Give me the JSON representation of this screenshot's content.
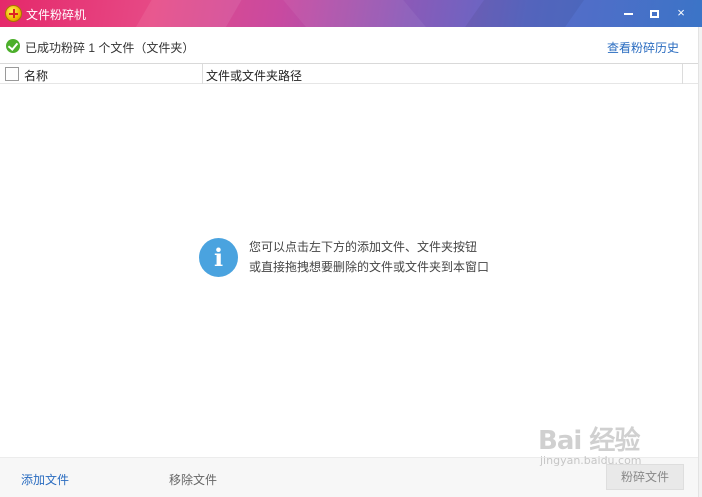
{
  "window": {
    "title": "文件粉碎机",
    "controls": {
      "minimize_icon": "minimize-icon",
      "maximize_icon": "maximize-icon",
      "close_glyph": "×"
    }
  },
  "status": {
    "message": "已成功粉碎 1 个文件（文件夹）",
    "history_link": "查看粉碎历史"
  },
  "table": {
    "columns": [
      "名称",
      "文件或文件夹路径"
    ],
    "rows": []
  },
  "empty_hint": {
    "icon_glyph": "i",
    "line1": "您可以点击左下方的添加文件、文件夹按钮",
    "line2": "或直接拖拽想要删除的文件或文件夹到本窗口"
  },
  "footer": {
    "add_file": "添加文件",
    "remove_file": "移除文件",
    "shred_button": "粉碎文件"
  },
  "watermark": {
    "text": "Bai 经验",
    "sub": "jingyan.baidu.com"
  },
  "colors": {
    "title_gradient_start": "#e5286a",
    "title_gradient_end": "#3b74c7",
    "link_blue": "#2a6cc0",
    "success_green": "#4caf2b",
    "info_blue": "#4aa3df"
  }
}
